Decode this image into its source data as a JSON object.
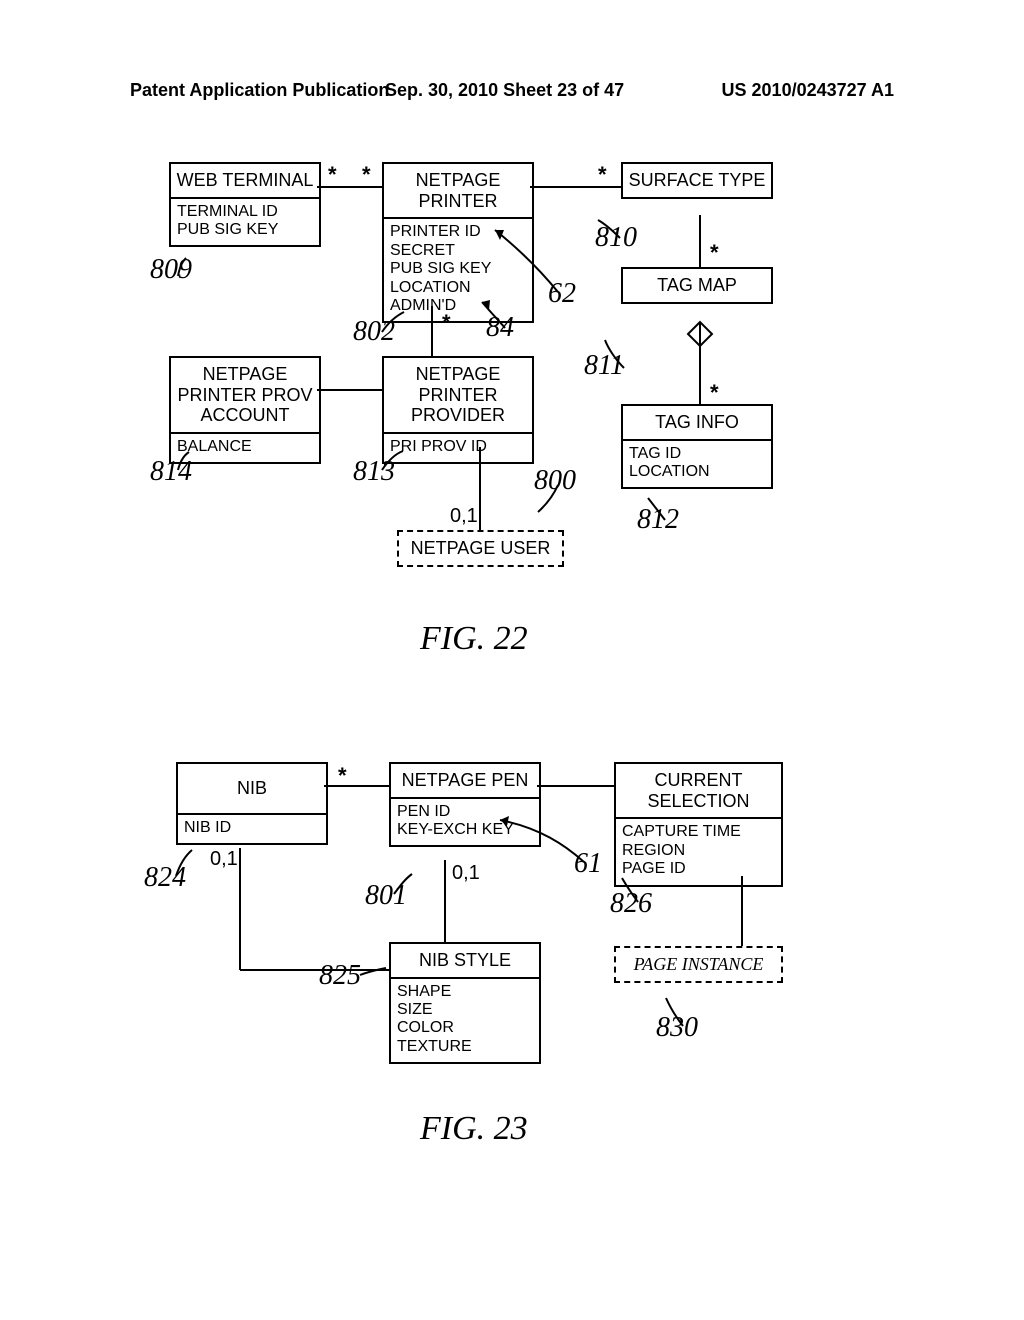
{
  "header": {
    "left": "Patent Application Publication",
    "center": "Sep. 30, 2010  Sheet 23 of 47",
    "right": "US 2010/0243727 A1"
  },
  "fig22": {
    "webTerminal": {
      "title": "WEB\nTERMINAL",
      "attrs": "TERMINAL ID\nPUB SIG KEY",
      "ref": "809"
    },
    "netpagePrinter": {
      "title": "NETPAGE\nPRINTER",
      "attrs": "PRINTER ID\nSECRET\nPUB SIG KEY\nLOCATION\nADMIN'D",
      "ref": "802"
    },
    "surfaceType": {
      "title": "SURFACE\nTYPE",
      "ref": "810"
    },
    "tagMap": {
      "title": "TAG\nMAP",
      "ref": "811"
    },
    "tagInfo": {
      "title": "TAG\nINFO",
      "attrs": "TAG ID\nLOCATION",
      "ref": "812"
    },
    "provAccount": {
      "title": "NETPAGE\nPRINTER PROV\nACCOUNT",
      "attrs": "BALANCE",
      "ref": "814"
    },
    "printerProvider": {
      "title": "NETPAGE\nPRINTER\nPROVIDER",
      "attrs": "PRI PROV ID",
      "ref": "813"
    },
    "netpageUser": {
      "title": "NETPAGE\nUSER",
      "ref": "800"
    },
    "leaders": {
      "a": "62",
      "b": "84"
    },
    "cards": {
      "s1": "*",
      "s2": "*",
      "s3": "*",
      "s4": "*",
      "s5": "*",
      "s6": "*",
      "c01": "0,1"
    },
    "caption": "FIG. 22"
  },
  "fig23": {
    "nib": {
      "title": "NIB",
      "attrs": "NIB ID",
      "ref": "824"
    },
    "netpagePen": {
      "title": "NETPAGE\nPEN",
      "attrs": "PEN ID\nKEY-EXCH KEY",
      "ref": "801"
    },
    "currentSelection": {
      "title": "CURRENT\nSELECTION",
      "attrs": "CAPTURE TIME\nREGION\nPAGE ID",
      "ref": "826"
    },
    "nibStyle": {
      "title": "NIB\nSTYLE",
      "attrs": "SHAPE\nSIZE\nCOLOR\nTEXTURE",
      "ref": "825"
    },
    "pageInstance": {
      "title": "PAGE\nINSTANCE",
      "ref": "830"
    },
    "leaders": {
      "a": "61"
    },
    "cards": {
      "s1": "*",
      "c01a": "0,1",
      "c01b": "0,1"
    },
    "caption": "FIG. 23"
  }
}
